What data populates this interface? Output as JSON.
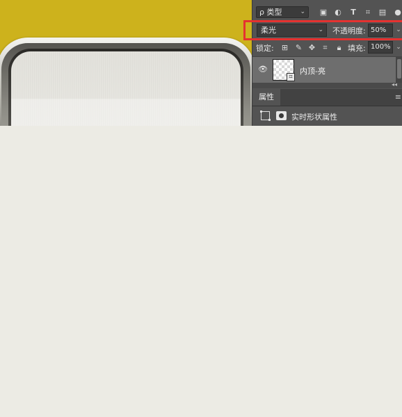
{
  "colors": {
    "canvas_background": "#cdb21c",
    "panel_background": "#535353",
    "highlight_border": "#e53230",
    "page_background": "#ecebe4"
  },
  "layers_panel": {
    "filter": {
      "label": "ρ 类型",
      "chevron": "⌄"
    },
    "filter_icons": [
      "image-filter-icon",
      "adjustment-filter-icon",
      "type-filter-icon",
      "shape-filter-icon",
      "smart-object-filter-icon",
      "toggle-filter-icon"
    ],
    "blend_mode": {
      "value": "柔光",
      "chevron": "⌄"
    },
    "opacity": {
      "label": "不透明度:",
      "value": "50%"
    },
    "lock": {
      "label": "锁定:"
    },
    "fill": {
      "label": "填充:",
      "value": "100%"
    },
    "layer": {
      "name": "内顶-亮",
      "visible": true
    }
  },
  "properties_panel": {
    "tab_label": "属性",
    "title": "实时形状属性"
  }
}
